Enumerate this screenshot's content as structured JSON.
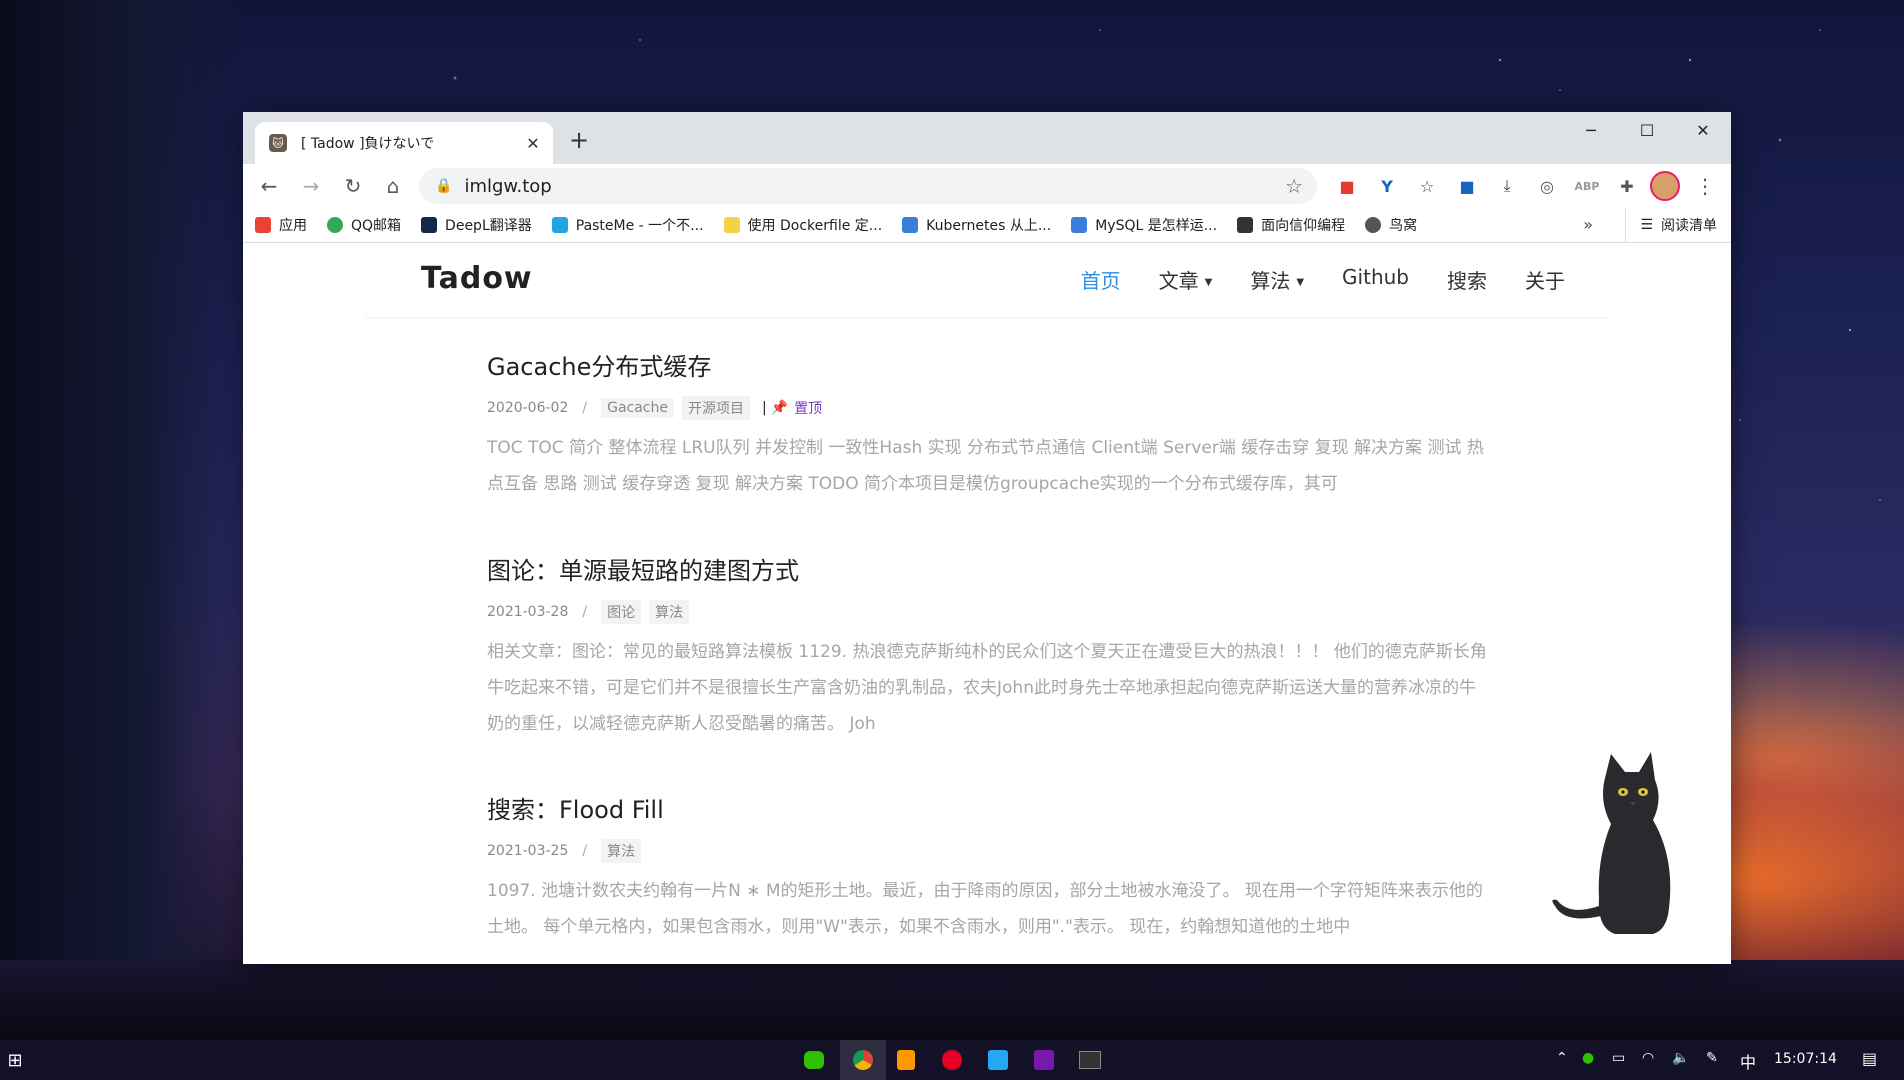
{
  "browser": {
    "tab_title": "[ Tadow ]負けないで",
    "url": "imlgw.top",
    "bookmarks": [
      {
        "label": "应用",
        "color": "#ea4335"
      },
      {
        "label": "QQ邮箱",
        "color": "#34a853"
      },
      {
        "label": "DeepL翻译器",
        "color": "#0f2b46"
      },
      {
        "label": "PasteMe - 一个不...",
        "color": "#1ea7e1"
      },
      {
        "label": "使用 Dockerfile 定...",
        "color": "#f5d14a"
      },
      {
        "label": "Kubernetes 从上...",
        "color": "#3b7ddd"
      },
      {
        "label": "MySQL 是怎样运...",
        "color": "#3b7ddd"
      },
      {
        "label": "面向信仰编程",
        "color": "#333333"
      },
      {
        "label": "鸟窝",
        "color": "#555555"
      }
    ],
    "bookmark_more": "»",
    "reading_list": "阅读清单"
  },
  "site": {
    "brand": "Tadow",
    "menu": {
      "home": "首页",
      "articles": "文章",
      "algorithms": "算法",
      "github": "Github",
      "search": "搜索",
      "about": "关于"
    }
  },
  "posts": [
    {
      "title": "Gacache分布式缓存",
      "date": "2020-06-02",
      "tags": [
        "Gacache",
        "开源项目"
      ],
      "pinned_label": "置顶",
      "excerpt": "TOC TOC 简介 整体流程 LRU队列 并发控制 一致性Hash 实现 分布式节点通信 Client端 Server端 缓存击穿 复现 解决方案 测试 热点互备 思路 测试 缓存穿透 复现 解决方案 TODO 简介本项目是模仿groupcache实现的一个分布式缓存库，其可"
    },
    {
      "title": "图论：单源最短路的建图方式",
      "date": "2021-03-28",
      "tags": [
        "图论",
        "算法"
      ],
      "excerpt": "相关文章：图论：常见的最短路算法模板 1129. 热浪德克萨斯纯朴的民众们这个夏天正在遭受巨大的热浪！！！ 他们的德克萨斯长角牛吃起来不错，可是它们并不是很擅长生产富含奶油的乳制品，农夫John此时身先士卒地承担起向德克萨斯运送大量的营养冰凉的牛奶的重任，以减轻德克萨斯人忍受酷暑的痛苦。 Joh"
    },
    {
      "title": "搜索：Flood Fill",
      "date": "2021-03-25",
      "tags": [
        "算法"
      ],
      "excerpt": "1097. 池塘计数农夫约翰有一片N ∗ M的矩形土地。最近，由于降雨的原因，部分土地被水淹没了。 现在用一个字符矩阵来表示他的土地。 每个单元格内，如果包含雨水，则用\"W\"表示，如果不含雨水，则用\".\"表示。 现在，约翰想知道他的土地中"
    }
  ],
  "taskbar": {
    "ime": "中",
    "clock": "15:07:14"
  }
}
